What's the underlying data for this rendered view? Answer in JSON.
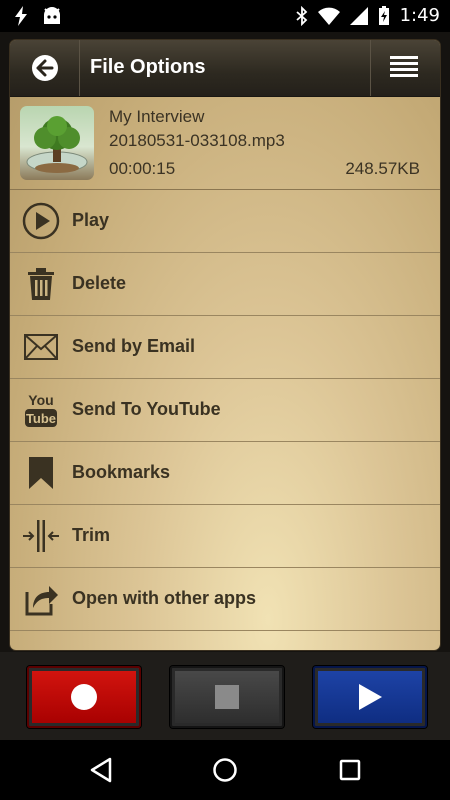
{
  "status_bar": {
    "time": "1:49",
    "left_icons": [
      "flash-icon",
      "android-icon"
    ],
    "right_icons": [
      "bluetooth-icon",
      "wifi-icon",
      "signal-icon",
      "battery-icon"
    ]
  },
  "header": {
    "title": "File Options",
    "back_icon": "back-arrow-icon",
    "menu_icon": "menu-icon"
  },
  "file": {
    "name": "My Interview",
    "filename": "20180531-033108.mp3",
    "duration": "00:00:15",
    "size": "248.57KB"
  },
  "options": [
    {
      "label": "Play",
      "icon": "play-circle-icon"
    },
    {
      "label": "Delete",
      "icon": "trash-icon"
    },
    {
      "label": "Send by Email",
      "icon": "envelope-icon"
    },
    {
      "label": "Send To YouTube",
      "icon": "youtube-icon"
    },
    {
      "label": "Bookmarks",
      "icon": "bookmark-icon"
    },
    {
      "label": "Trim",
      "icon": "trim-icon"
    },
    {
      "label": "Open with other apps",
      "icon": "share-icon"
    }
  ],
  "youtube_icon_text": {
    "top": "You",
    "bottom": "Tube"
  },
  "controls": {
    "record_icon": "record-icon",
    "stop_icon": "stop-icon",
    "play_icon": "play-icon",
    "colors": {
      "record": "#c10000",
      "stop": "#3a3a3a",
      "play": "#16399a"
    }
  },
  "nav": [
    "back-nav-icon",
    "home-nav-icon",
    "recents-nav-icon"
  ]
}
